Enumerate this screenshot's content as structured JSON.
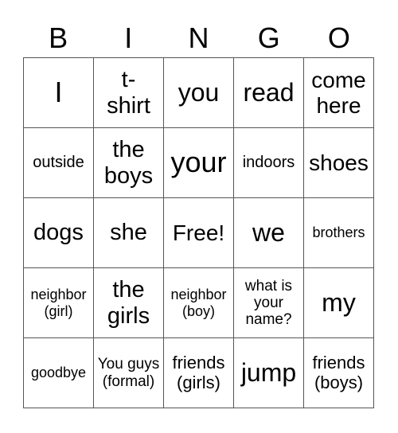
{
  "header": [
    "B",
    "I",
    "N",
    "G",
    "O"
  ],
  "rows": [
    [
      "I",
      "t-\nshirt",
      "you",
      "read",
      "come here"
    ],
    [
      "outside",
      "the boys",
      "your",
      "indoors",
      "shoes"
    ],
    [
      "dogs",
      "she",
      "Free!",
      "we",
      "brothers"
    ],
    [
      "neighbor (girl)",
      "the girls",
      "neighbor (boy)",
      "what is your name?",
      "my"
    ],
    [
      "goodbye",
      "You guys (formal)",
      "friends (girls)",
      "jump",
      "friends (boys)"
    ]
  ]
}
